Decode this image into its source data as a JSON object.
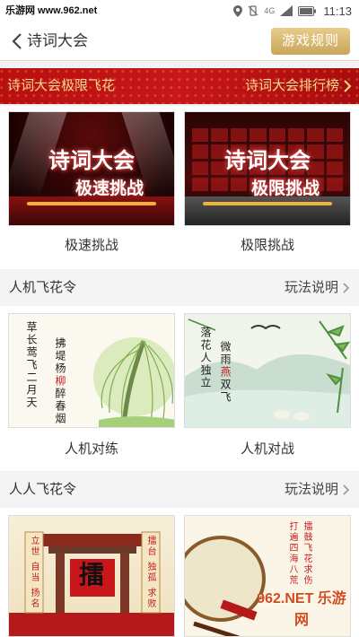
{
  "watermark_top": "乐游网 www.962.net",
  "status": {
    "time": "11:13",
    "signal": "4G"
  },
  "nav": {
    "title": "诗词大会",
    "rules_button": "游戏规则"
  },
  "banner": {
    "left": "诗词大会极限飞花",
    "right": "诗词大会排行榜"
  },
  "challenge": {
    "cards": [
      {
        "caption": "极速挑战",
        "art_title1": "诗词大会",
        "art_title2": "极速挑战"
      },
      {
        "caption": "极限挑战",
        "art_title1": "诗词大会",
        "art_title2": "极限挑战"
      }
    ]
  },
  "section_ai": {
    "title": "人机飞花令",
    "more": "玩法说明",
    "cards": [
      {
        "caption": "人机对练",
        "poem_a": "草长莺飞二月天",
        "poem_b_pre": "拂堤杨",
        "poem_b_hl": "柳",
        "poem_b_post": "醉春烟"
      },
      {
        "caption": "人机对战",
        "poem_a": "落花人独立",
        "poem_b_pre": "微雨",
        "poem_b_hl": "燕",
        "poem_b_post": "双飞"
      }
    ]
  },
  "section_pvp": {
    "title": "人人飞花令",
    "more": "玩法说明",
    "cards": [
      {
        "poster_char": "擂",
        "poster_left": "立世 自当 扬名",
        "poster_right": "擂台 独孤 求败"
      },
      {
        "poster_a": "擂鼓飞花求伤",
        "poster_b": "打遍四海八荒"
      }
    ]
  },
  "watermark_bottom": "962.NET 乐游网",
  "colors": {
    "accent_gold": "#c9a55a",
    "banner_red": "#c8161b",
    "banner_text": "#f7dc8a"
  }
}
